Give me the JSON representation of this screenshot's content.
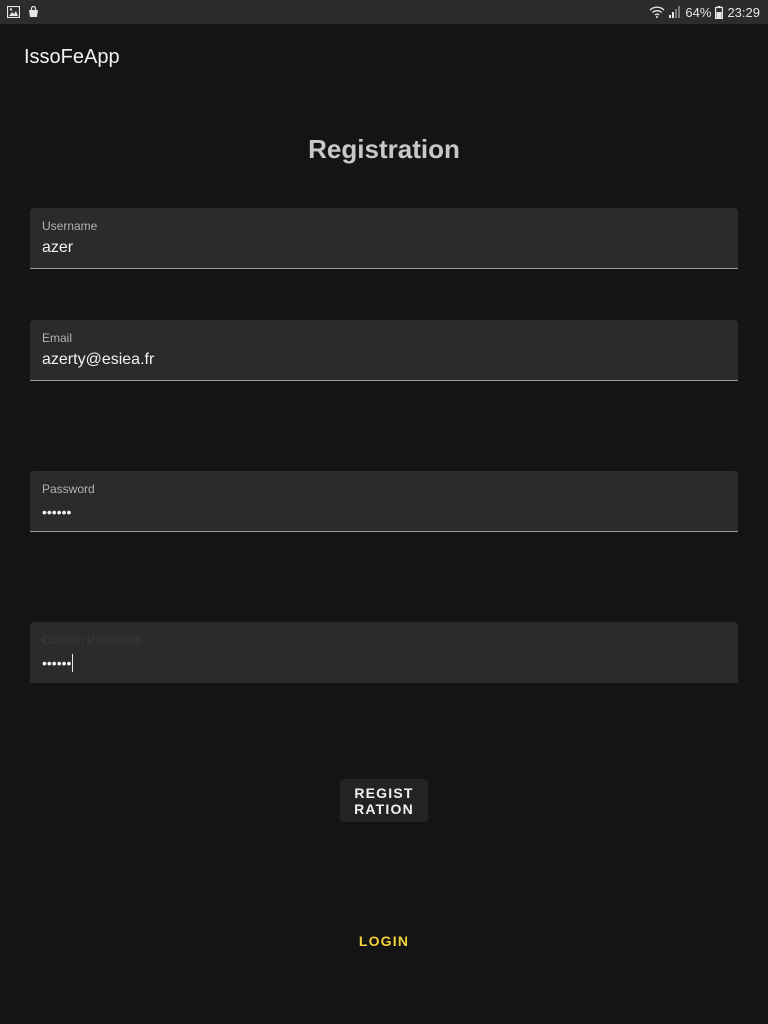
{
  "status_bar": {
    "battery_percent": "64%",
    "time": "23:29",
    "left_icons": [
      "image-icon",
      "shopping-bag-icon"
    ],
    "right_icons": [
      "wifi-icon",
      "signal-icon",
      "battery-icon"
    ]
  },
  "app": {
    "title": "IssoFeApp"
  },
  "form": {
    "heading": "Registration",
    "username": {
      "label": "Username",
      "value": "azer"
    },
    "email": {
      "label": "Email",
      "value": "azerty@esiea.fr"
    },
    "password": {
      "label": "Password",
      "value": "••••••"
    },
    "confirm_password": {
      "label": "Confirm Password",
      "value": "••••••"
    },
    "register_label": "REGIST RATION",
    "login_label": "LOGIN"
  },
  "colors": {
    "background": "#141414",
    "field_background": "#2b2b2b",
    "login_accent": "#f3d23c"
  }
}
